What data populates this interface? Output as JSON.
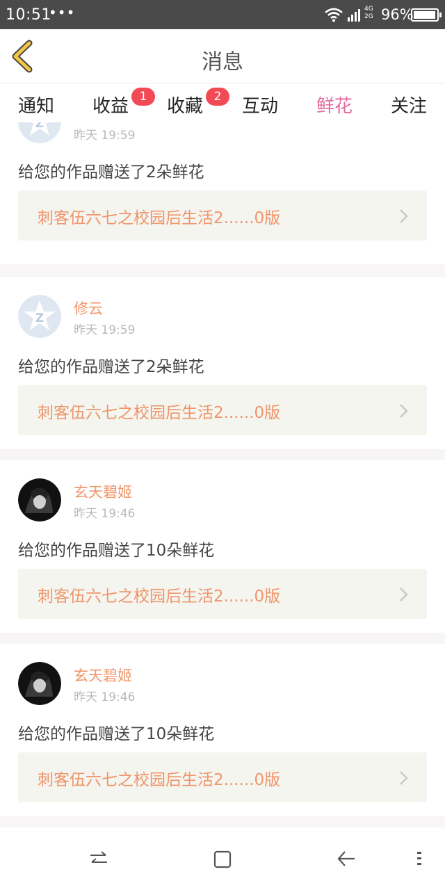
{
  "status_bar": {
    "time": "10:51",
    "dots": "•••",
    "network_top": "4G",
    "network_bottom": "2G",
    "battery": "96%"
  },
  "header": {
    "title": "消息"
  },
  "tabs": [
    {
      "label": "通知"
    },
    {
      "label": "收益",
      "badge": "1"
    },
    {
      "label": "收藏",
      "badge": "2"
    },
    {
      "label": "互动"
    },
    {
      "label": "鲜花",
      "active": true
    },
    {
      "label": "关注"
    }
  ],
  "feed": [
    {
      "username": "修云",
      "time": "昨天 19:59",
      "message": "给您的作品赠送了2朵鲜花",
      "work_title": "刺客伍六七之校园后生活2......0版",
      "avatar": "default-star-avatar"
    },
    {
      "username": "修云",
      "time": "昨天 19:59",
      "message": "给您的作品赠送了2朵鲜花",
      "work_title": "刺客伍六七之校园后生活2......0版",
      "avatar": "default-star-avatar"
    },
    {
      "username": "玄天碧姬",
      "time": "昨天 19:46",
      "message": "给您的作品赠送了10朵鲜花",
      "work_title": "刺客伍六七之校园后生活2......0版",
      "avatar": "dark-anime-avatar"
    },
    {
      "username": "玄天碧姬",
      "time": "昨天 19:46",
      "message": "给您的作品赠送了10朵鲜花",
      "work_title": "刺客伍六七之校园后生活2......0版",
      "avatar": "dark-anime-avatar"
    }
  ],
  "colors": {
    "accent_pink": "#e56a9e",
    "accent_orange": "#f0956a",
    "badge_red": "#f24a55",
    "back_yellow": "#f2c744"
  }
}
